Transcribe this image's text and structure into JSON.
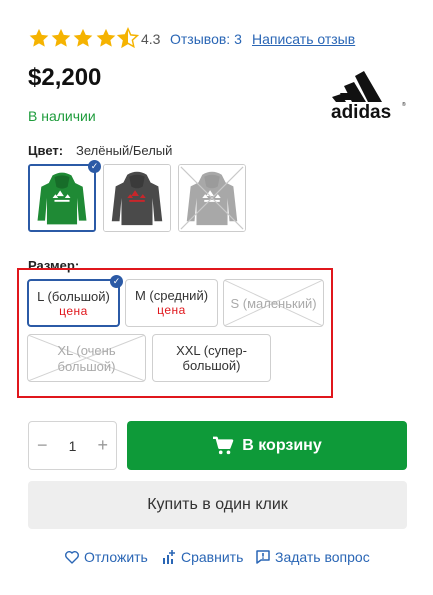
{
  "rating": {
    "value": "4.3",
    "stars_filled": 4.3,
    "stars_total": 5,
    "reviews": "Отзывов: 3",
    "write_review": "Написать отзыв"
  },
  "product": {
    "price": "$2,200",
    "availability": "В наличии",
    "brand_icon": "adidas-logo"
  },
  "color": {
    "label": "Цвет:",
    "value": "Зелёный/Белый",
    "options": [
      {
        "name": "green-hoodie",
        "color": "#1f8a35",
        "selected": true,
        "available": true
      },
      {
        "name": "dark-grey-hoodie",
        "color": "#4a4a4a",
        "selected": false,
        "available": true
      },
      {
        "name": "grey-hoodie",
        "color": "#7a7a7a",
        "selected": false,
        "available": false
      }
    ]
  },
  "size": {
    "label": "Размер:",
    "options": [
      {
        "label": "L (большой)",
        "note": "цена",
        "selected": true,
        "available": true
      },
      {
        "label": "M (средний)",
        "note": "цена",
        "selected": false,
        "available": true
      },
      {
        "label": "S (маленький)",
        "selected": false,
        "available": false
      },
      {
        "label_line1": "XL (очень",
        "label_line2": "большой)",
        "selected": false,
        "available": false
      },
      {
        "label_line1": "XXL (супер-",
        "label_line2": "большой)",
        "selected": false,
        "available": true
      }
    ]
  },
  "purchase": {
    "qty_minus": "−",
    "qty_value": "1",
    "qty_plus": "+",
    "cart_button": "В корзину",
    "one_click_button": "Купить в один клик"
  },
  "actions": {
    "wishlist": "Отложить",
    "compare": "Сравнить",
    "ask": "Задать вопрос"
  },
  "colors": {
    "accent_blue": "#2b5aa6",
    "link_blue": "#2a66b5",
    "green": "#0e9a39",
    "highlight_red": "#e0161c",
    "star": "#f5b301"
  }
}
